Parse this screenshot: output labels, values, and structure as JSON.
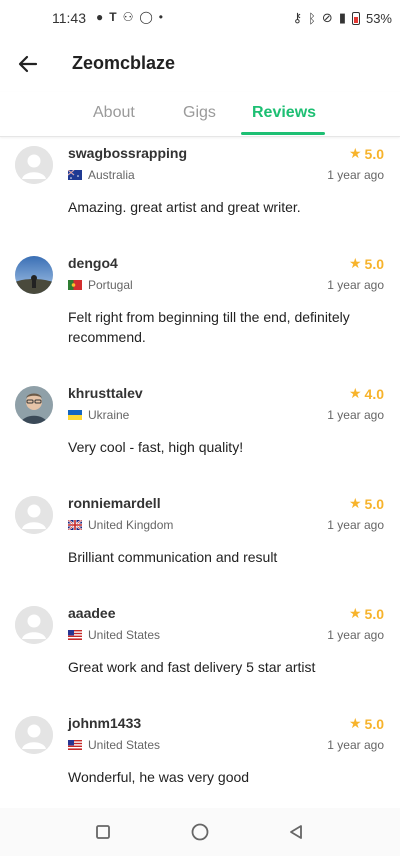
{
  "status_bar": {
    "time": "11:43",
    "battery": "53%"
  },
  "header": {
    "title": "Zeomcblaze"
  },
  "tabs": [
    {
      "label": "About"
    },
    {
      "label": "Gigs"
    },
    {
      "label": "Reviews"
    }
  ],
  "active_tab": "Reviews",
  "accent_color": "#1dbf73",
  "star_color": "#f7b32b",
  "reviews": [
    {
      "username": "swagbossrapping",
      "rating": "5.0",
      "country": "Australia",
      "time_ago": "1 year ago",
      "comment": "Amazing. great artist and great writer.",
      "avatar": "default-avatar"
    },
    {
      "username": "dengo4",
      "rating": "5.0",
      "country": "Portugal",
      "time_ago": "1 year ago",
      "comment": "Felt right from beginning till the end, definitely recommend.",
      "avatar": "photo-landscape"
    },
    {
      "username": "khrusttalev",
      "rating": "4.0",
      "country": "Ukraine",
      "time_ago": "1 year ago",
      "comment": "Very cool - fast, high quality!",
      "avatar": "photo-person"
    },
    {
      "username": "ronniemardell",
      "rating": "5.0",
      "country": "United Kingdom",
      "time_ago": "1 year ago",
      "comment": "Brilliant communication and result",
      "avatar": "default-avatar"
    },
    {
      "username": "aaadee",
      "rating": "5.0",
      "country": "United States",
      "time_ago": "1 year ago",
      "comment": "Great work and fast delivery 5 star artist",
      "avatar": "default-avatar"
    },
    {
      "username": "johnm1433",
      "rating": "5.0",
      "country": "United States",
      "time_ago": "1 year ago",
      "comment": "Wonderful, he was very good",
      "avatar": "default-avatar"
    }
  ]
}
